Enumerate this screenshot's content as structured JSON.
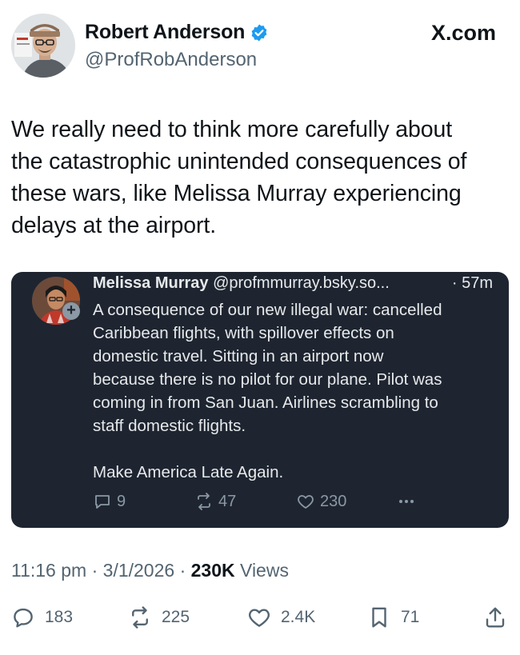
{
  "header": {
    "display_name": "Robert Anderson",
    "handle": "@ProfRobAnderson",
    "brand": "X.com",
    "verified": true
  },
  "tweet": {
    "text": "We really need to think more carefully about\nthe catastrophic unintended consequences of\nthese wars, like Melissa Murray experiencing\ndelays at the airport."
  },
  "quote": {
    "name": "Melissa Murray",
    "handle": "@profmmurray.bsky.so...",
    "time": "· 57m",
    "body": "A consequence of our new illegal war: cancelled\nCaribbean flights, with spillover effects on\ndomestic travel. Sitting in an airport now\nbecause there is no pilot for our plane. Pilot was\ncoming in from San Juan. Airlines scrambling to\nstaff domestic flights.\n\nMake America Late Again.",
    "replies": "9",
    "reposts": "47",
    "likes": "230"
  },
  "meta": {
    "time": "11:16 pm",
    "date": "3/1/2026",
    "views": "230K",
    "views_label": "Views"
  },
  "actions": {
    "replies": "183",
    "reposts": "225",
    "likes": "2.4K",
    "bookmarks": "71"
  },
  "colors": {
    "text": "#0f1419",
    "secondary": "#536471",
    "verified": "#1d9bf0",
    "quote_bg": "#1e2531"
  },
  "icons": [
    "verified-badge-icon",
    "reply-icon",
    "repost-icon",
    "like-icon",
    "more-icon",
    "bookmark-icon",
    "share-icon"
  ]
}
